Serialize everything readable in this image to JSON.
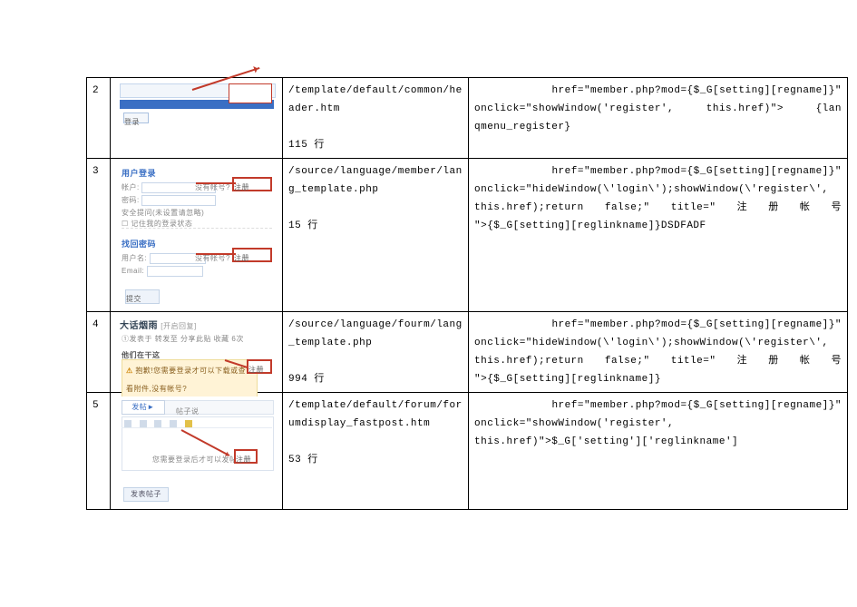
{
  "rows": [
    {
      "num": "2",
      "path": "/template/default/common/header.htm",
      "line_label": "115 行",
      "code": {
        "l1_pre": "",
        "l1_href": "href=\"member.php?mod={$_G[setting][regname]}\"",
        "l2_a": "onclick=\"showWindow('register',",
        "l2_b": "this.href)\">",
        "l2_c": "{lan",
        "l3": "qmenu_register}"
      },
      "shot": {
        "btn_label": "登录"
      }
    },
    {
      "num": "3",
      "path": "/source/language/member/lang_template.php",
      "line_label": "15 行",
      "code": {
        "l1_href": "href=\"member.php?mod={$_G[setting][regname]}\"",
        "l2": "onclick=\"hideWindow(\\'login\\');showWindow(\\'register\\',",
        "l3_a": "this.href);return",
        "l3_b": "false;\"",
        "l3_c": "title=\"",
        "l3_d": "注",
        "l3_e": "册",
        "l3_f": "帐",
        "l3_g": "号",
        "l4": "\">{$_G[setting][reglinkname]}DSDFADF"
      },
      "shot": {
        "section1_title": "用户登录",
        "reg_hint": "没有帐号?",
        "reg_btn": "注册",
        "remember": "记住我的登录状态",
        "section2_title": "找回密码",
        "field_user": "用户名:",
        "field_email": "Email:",
        "submit": "提交"
      }
    },
    {
      "num": "4",
      "path": "/source/language/fourm/lang_template.php",
      "line_label": "994 行",
      "code": {
        "l1_href": "href=\"member.php?mod={$_G[setting][regname]}\"",
        "l2": "onclick=\"hideWindow(\\'login\\');showWindow(\\'register\\',",
        "l3_a": "this.href);return",
        "l3_b": "false;\"",
        "l3_c": "title=\"",
        "l3_d": "注",
        "l3_e": "册",
        "l3_f": "帐",
        "l3_g": "号",
        "l4": "\">{$_G[setting][reglinkname]}"
      },
      "shot": {
        "title": "大话烟雨",
        "suffix": "[开启回复]",
        "crumbs": "①发表于   转发至   分享此贴   收藏   6次",
        "sec": "他们在干这",
        "warn_pre": "抱歉!您需要登录才可以下载或查看附件,没有帐号?",
        "reg_btn": "注册"
      }
    },
    {
      "num": "5",
      "path": "/template/default/forum/forumdisplay_fastpost.htm",
      "line_label": "53 行",
      "code": {
        "l1_href": "href=\"member.php?mod={$_G[setting][regname]}\"",
        "l2_a": "onclick=\"showWindow('register',",
        "l3": "this.href)\">$_G['setting']['reglinkname']"
      },
      "shot": {
        "tab": "发帖► ",
        "tab2": "帖子说",
        "caption_pre": "您需要登录后才可以发帖",
        "caption_login": "登录",
        "reg_btn": "注册",
        "post": "发表帖子"
      }
    }
  ]
}
